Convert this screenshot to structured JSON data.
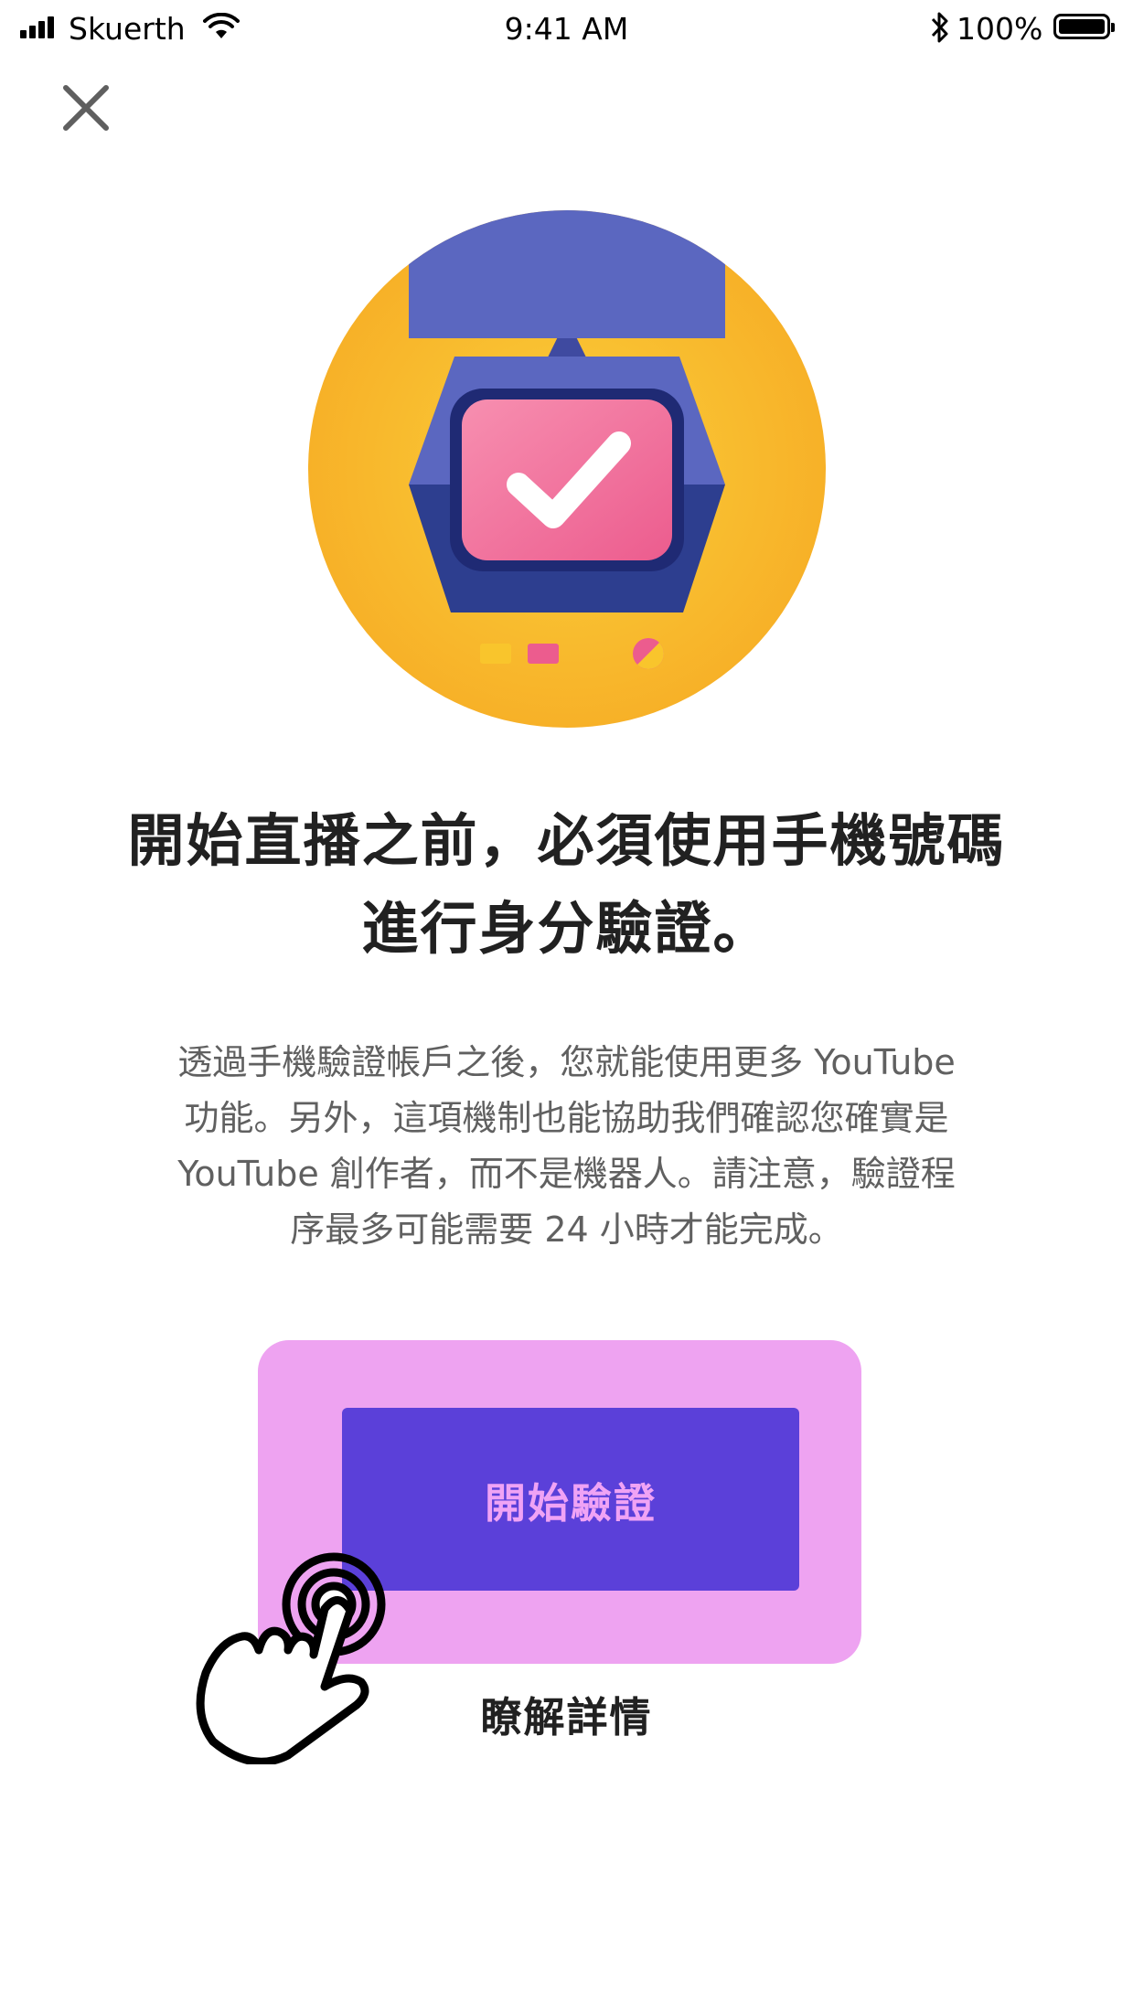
{
  "status_bar": {
    "carrier": "Skuerth",
    "time": "9:41 AM",
    "battery": "100%",
    "battery_level": 1.0
  },
  "header": {
    "close_icon": "close-icon"
  },
  "hero": {
    "icon": "satellite-tv-checkmark-illustration"
  },
  "main": {
    "title_lines": [
      "開始直播之前，必須使用手機號碼",
      "進行身分驗證。"
    ],
    "description_lines": [
      "透過手機驗證帳戶之後，您就能使用更多 YouTube",
      "功能。另外，這項機制也能協助我們確認您確實是",
      "YouTube 創作者，而不是機器人。請注意，驗證程",
      "序最多可能需要 24 小時才能完成。"
    ],
    "primary_button": "開始驗證",
    "secondary_link": "瞭解詳情"
  },
  "colors": {
    "highlight": "#eea3f1",
    "button_bg": "#5b40d9",
    "button_text": "#f0a3f5",
    "hero_circle": "#f9b82a"
  }
}
